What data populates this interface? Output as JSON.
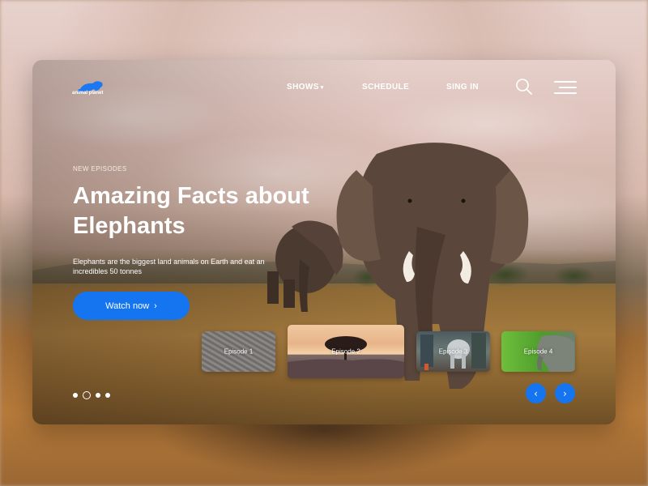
{
  "brand": {
    "logo_text": "animal planet"
  },
  "nav": {
    "items": [
      {
        "label": "SHOWS",
        "has_dropdown": true
      },
      {
        "label": "SCHEDULE",
        "has_dropdown": false
      },
      {
        "label": "SING IN",
        "has_dropdown": false
      }
    ],
    "search_icon": "search-icon",
    "menu_icon": "hamburger-menu-icon"
  },
  "hero": {
    "eyebrow": "NEW EPISODES",
    "title": "Amazing Facts about Elephants",
    "description": "Elephants are the biggest land animals on Earth and eat an incredibles 50 tonnes",
    "cta_label": "Watch now",
    "cta_icon": "chevron-right-icon"
  },
  "episodes": [
    {
      "label": "Episode 1",
      "active": false
    },
    {
      "label": "Episode 2",
      "active": true
    },
    {
      "label": "Episode 3",
      "active": false
    },
    {
      "label": "Episode 4",
      "active": false
    }
  ],
  "pager": {
    "count": 4,
    "active_index": 1
  },
  "carousel": {
    "prev_icon": "chevron-left-icon",
    "next_icon": "chevron-right-icon"
  },
  "colors": {
    "accent": "#1575f0",
    "text": "#ffffff"
  }
}
